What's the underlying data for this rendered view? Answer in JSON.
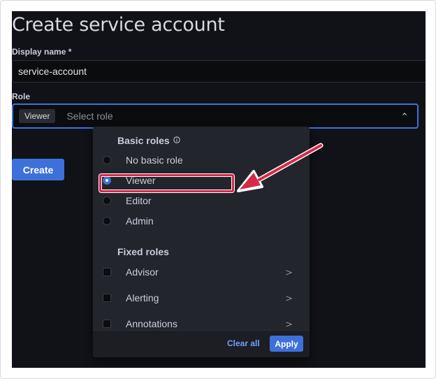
{
  "page": {
    "title": "Create service account"
  },
  "form": {
    "display_name_label": "Display name *",
    "display_name_value": "service-account",
    "role_label": "Role",
    "role_chip": "Viewer",
    "role_placeholder": "Select role",
    "create_label": "Create"
  },
  "dropdown": {
    "basic_title": "Basic roles",
    "basic_options": [
      {
        "label": "No basic role",
        "selected": false
      },
      {
        "label": "Viewer",
        "selected": true
      },
      {
        "label": "Editor",
        "selected": false
      },
      {
        "label": "Admin",
        "selected": false
      }
    ],
    "fixed_title": "Fixed roles",
    "fixed_options": [
      {
        "label": "Advisor",
        "chevron": ">"
      },
      {
        "label": "Alerting",
        "chevron": ">"
      },
      {
        "label": "Annotations",
        "chevron": ">"
      }
    ],
    "clear_all_label": "Clear all",
    "apply_label": "Apply"
  },
  "colors": {
    "background": "#111217",
    "accent": "#3d71d9",
    "annotation": "#d6294a"
  }
}
